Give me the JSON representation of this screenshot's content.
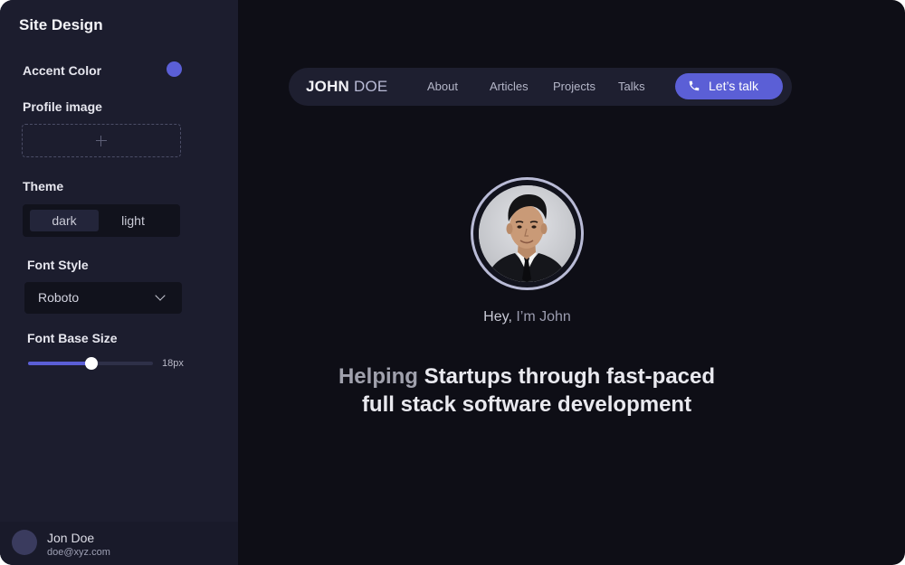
{
  "sidebar": {
    "title": "Site Design",
    "accent_label": "Accent Color",
    "accent_color": "#5b5fd6",
    "profile_label": "Profile image",
    "upload_icon": "plus-icon",
    "theme_label": "Theme",
    "theme_options": [
      "dark",
      "light"
    ],
    "theme_selected": "dark",
    "font_style_label": "Font Style",
    "font_selected": "Roboto",
    "font_size_label": "Font Base Size",
    "font_size_value": "18px",
    "font_size_fraction": 0.51
  },
  "user": {
    "name": "Jon Doe",
    "email": "doe@xyz.com"
  },
  "preview": {
    "brand_first": "JOHN",
    "brand_last": "DOE",
    "nav": [
      "About",
      "Articles",
      "Projects",
      "Talks"
    ],
    "cta_label": "Let’s talk",
    "cta_icon": "phone-icon",
    "greeting_prefix": "Hey,",
    "greeting_name": "I’m John",
    "headline_words": {
      "w1": "Helping",
      "w2": "Startups",
      "w3": "through",
      "w4": "fast-paced",
      "w5": "full stack",
      "w6": "software",
      "w7": "development"
    }
  }
}
